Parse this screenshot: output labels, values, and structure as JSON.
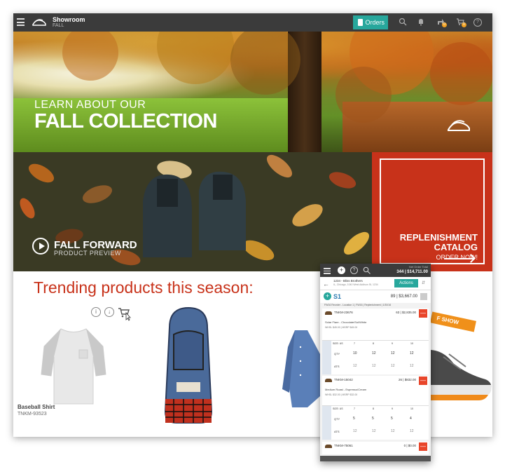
{
  "topbar": {
    "brand": "Showroom",
    "season": "FALL",
    "orders_label": "Orders",
    "share_badge": "0",
    "cart_badge": "0",
    "help_label": "?",
    "search_icon": "search-icon",
    "bell_icon": "bell-icon"
  },
  "hero": {
    "line1": "LEARN ABOUT OUR",
    "line2": "FALL COLLECTION"
  },
  "fall_forward": {
    "title": "FALL FORWARD",
    "subtitle": "PRODUCT PREVIEW"
  },
  "replenishment": {
    "line1": "REPLENISHMENT",
    "line2": "CATALOG",
    "cta": "ORDER NOW!"
  },
  "trending": {
    "heading": "Trending products this season:",
    "product_actions": [
      "i",
      "↓"
    ],
    "product_name": "Baseball Shirt",
    "product_sku": "TNKM-93523",
    "ribbon": "F SHOW"
  },
  "mobile": {
    "net_total_label": "Net Order Total",
    "net_total": "344 | $14,711.00",
    "account": "1234 - Bliss Brothers",
    "address": "IL, Chicago, 1040 West Addison St, 1234",
    "actions_label": "Actions",
    "shipment": "S1",
    "shipment_value": "89 | $3,667.00",
    "sub_header": "FW16 Reorder - Location 1 | FW16 | Replenishment | 1/30/16",
    "items": [
      {
        "sku": "TNKM-23676",
        "value": "63 | $2,835.00",
        "name": "Solar Flare - Chocolate/Sol/White",
        "price": "WHSL $45.00 | MSRP $45.00",
        "size_label": "SIZE: US",
        "sizes": [
          "7",
          "8",
          "9",
          "10"
        ],
        "qty": [
          "10",
          "12",
          "12",
          "12"
        ],
        "ats": [
          "12",
          "12",
          "12",
          "12"
        ]
      },
      {
        "sku": "TNKM-15042",
        "value": "26 | $832.00",
        "name": "Medium Roast - Espresso/Cream",
        "price": "WHSL $32.00 | MSRP $32.00",
        "size_label": "SIZE: US",
        "sizes": [
          "7",
          "8",
          "9",
          "10"
        ],
        "qty": [
          "5",
          "5",
          "5",
          "4"
        ],
        "ats": [
          "12",
          "12",
          "12",
          "12"
        ]
      },
      {
        "sku": "TNKM-75061",
        "value": "0 | $0.00"
      }
    ],
    "row_labels": {
      "qty": "QTY",
      "ats": "ATS"
    }
  },
  "colors": {
    "accent_teal": "#27a79c",
    "brand_red": "#c8321a",
    "topbar": "#3b3b3b"
  }
}
